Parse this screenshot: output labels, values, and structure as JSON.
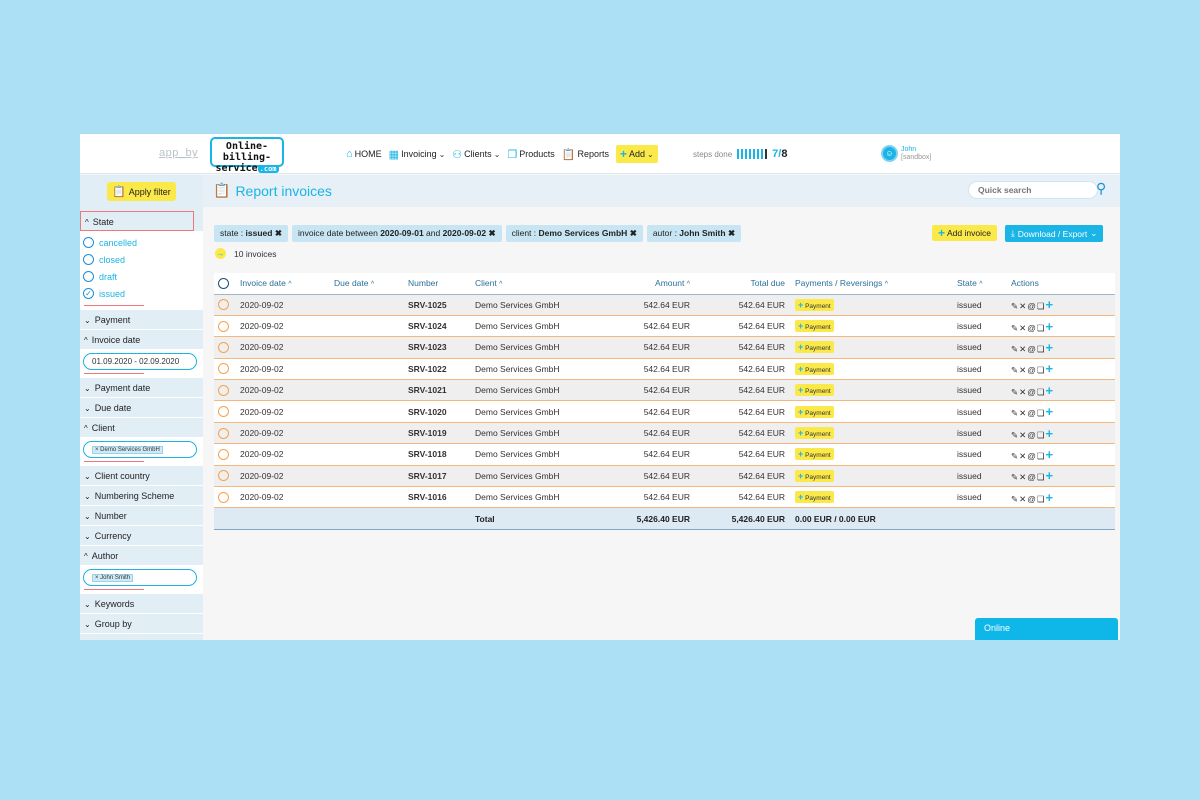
{
  "header": {
    "app_by": "app_by",
    "logo_line1": "Online-billing-",
    "logo_line2": "service",
    "logo_com": ".com",
    "nav": [
      {
        "label": "HOME",
        "icon": "home-icon"
      },
      {
        "label": "Invoicing",
        "icon": "invoice-icon",
        "dropdown": true
      },
      {
        "label": "Clients",
        "icon": "clients-icon",
        "dropdown": true
      },
      {
        "label": "Products",
        "icon": "products-icon"
      },
      {
        "label": "Reports",
        "icon": "reports-icon"
      }
    ],
    "add_label": "Add",
    "steps_label": "steps done",
    "steps_done": 7,
    "steps_total": 8,
    "steps_done_text": "7/",
    "steps_total_text": "8",
    "user_name": "John",
    "user_sub": "[sandbox]"
  },
  "sidebar": {
    "apply_label": "Apply filter",
    "state_label": "State",
    "states": [
      {
        "label": "cancelled",
        "checked": false
      },
      {
        "label": "closed",
        "checked": false
      },
      {
        "label": "draft",
        "checked": false
      },
      {
        "label": "issued",
        "checked": true
      }
    ],
    "payment_label": "Payment",
    "invoice_date_label": "Invoice date",
    "invoice_date_value": "01.09.2020 - 02.09.2020",
    "payment_date_label": "Payment date",
    "due_date_label": "Due date",
    "client_label": "Client",
    "client_tag": "Demo Services GmbH",
    "client_country_label": "Client country",
    "numbering_label": "Numbering Scheme",
    "number_label": "Number",
    "currency_label": "Currency",
    "author_label": "Author",
    "author_tag": "John Smith",
    "keywords_label": "Keywords",
    "group_by_label": "Group by"
  },
  "main": {
    "title": "Report invoices",
    "search_placeholder": "Quick search",
    "chips": [
      {
        "prefix": "state : ",
        "value": "issued"
      },
      {
        "prefix": "invoice date between ",
        "value": "2020-09-01",
        "mid": " and ",
        "value2": "2020-09-02"
      },
      {
        "prefix": "client : ",
        "value": "Demo Services GmbH"
      },
      {
        "prefix": "autor : ",
        "value": "John Smith"
      }
    ],
    "count_text": "10 invoices",
    "add_invoice_label": "Add invoice",
    "export_label": "Download / Export",
    "columns": [
      "Invoice date",
      "Due date",
      "Number",
      "Client",
      "Amount",
      "Total due",
      "Payments / Reversings",
      "State",
      "Actions"
    ],
    "rows": [
      {
        "date": "2020-09-02",
        "due": "",
        "number": "SRV-1025",
        "client": "Demo Services GmbH",
        "amount": "542.64 EUR",
        "total_due": "542.64 EUR",
        "payment": "Payment",
        "state": "issued"
      },
      {
        "date": "2020-09-02",
        "due": "",
        "number": "SRV-1024",
        "client": "Demo Services GmbH",
        "amount": "542.64 EUR",
        "total_due": "542.64 EUR",
        "payment": "Payment",
        "state": "issued"
      },
      {
        "date": "2020-09-02",
        "due": "",
        "number": "SRV-1023",
        "client": "Demo Services GmbH",
        "amount": "542.64 EUR",
        "total_due": "542.64 EUR",
        "payment": "Payment",
        "state": "issued"
      },
      {
        "date": "2020-09-02",
        "due": "",
        "number": "SRV-1022",
        "client": "Demo Services GmbH",
        "amount": "542.64 EUR",
        "total_due": "542.64 EUR",
        "payment": "Payment",
        "state": "issued"
      },
      {
        "date": "2020-09-02",
        "due": "",
        "number": "SRV-1021",
        "client": "Demo Services GmbH",
        "amount": "542.64 EUR",
        "total_due": "542.64 EUR",
        "payment": "Payment",
        "state": "issued"
      },
      {
        "date": "2020-09-02",
        "due": "",
        "number": "SRV-1020",
        "client": "Demo Services GmbH",
        "amount": "542.64 EUR",
        "total_due": "542.64 EUR",
        "payment": "Payment",
        "state": "issued"
      },
      {
        "date": "2020-09-02",
        "due": "",
        "number": "SRV-1019",
        "client": "Demo Services GmbH",
        "amount": "542.64 EUR",
        "total_due": "542.64 EUR",
        "payment": "Payment",
        "state": "issued"
      },
      {
        "date": "2020-09-02",
        "due": "",
        "number": "SRV-1018",
        "client": "Demo Services GmbH",
        "amount": "542.64 EUR",
        "total_due": "542.64 EUR",
        "payment": "Payment",
        "state": "issued"
      },
      {
        "date": "2020-09-02",
        "due": "",
        "number": "SRV-1017",
        "client": "Demo Services GmbH",
        "amount": "542.64 EUR",
        "total_due": "542.64 EUR",
        "payment": "Payment",
        "state": "issued"
      },
      {
        "date": "2020-09-02",
        "due": "",
        "number": "SRV-1016",
        "client": "Demo Services GmbH",
        "amount": "542.64 EUR",
        "total_due": "542.64 EUR",
        "payment": "Payment",
        "state": "issued"
      }
    ],
    "total": {
      "label": "Total",
      "amount": "5,426.40 EUR",
      "total_due": "5,426.40 EUR",
      "payments": "0.00 EUR / 0.00 EUR"
    }
  },
  "chat": {
    "label": "Online"
  },
  "colors": {
    "accent": "#1ab4e6",
    "highlight": "#fbe94a",
    "state_issued": "#f7941d",
    "due": "#aa3333"
  }
}
